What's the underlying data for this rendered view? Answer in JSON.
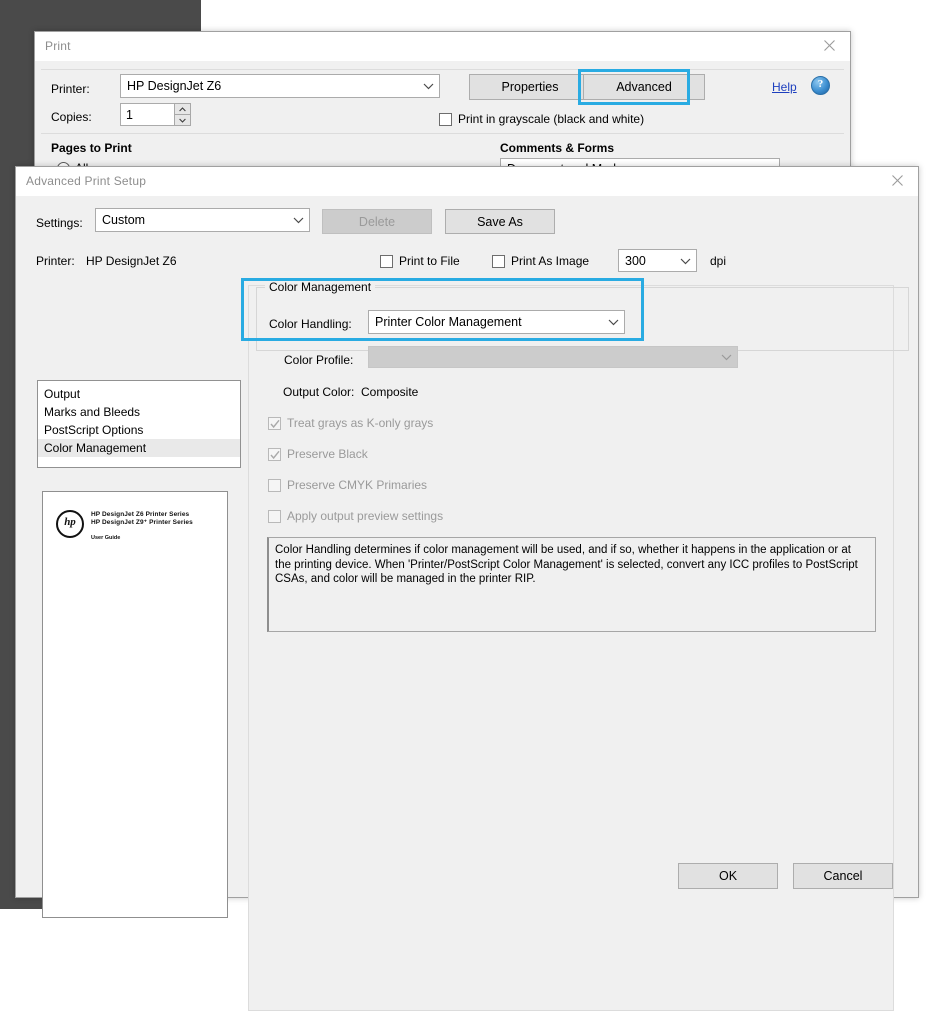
{
  "colors": {
    "highlight_accent": "#29ABE2",
    "desktop_backdrop": "#4a4a4a",
    "dialog_face": "#f0f0f0",
    "link_blue": "#1d3fbe"
  },
  "print_dialog": {
    "title": "Print",
    "close_icon": "close-icon",
    "printer_label": "Printer:",
    "printer_value": "HP DesignJet Z6",
    "copies_label": "Copies:",
    "copies_value": "1",
    "properties_button": "Properties",
    "advanced_button": "Advanced",
    "help_link": "Help",
    "help_icon": "question-mark-icon",
    "grayscale_checkbox": "Print in grayscale (black and white)",
    "grayscale_checked": false,
    "pages_to_print_label": "Pages to Print",
    "pages_all_option": "All",
    "comments_and_forms_label": "Comments & Forms",
    "comments_and_forms_value": "Document and Markups"
  },
  "advanced_dialog": {
    "title": "Advanced Print Setup",
    "close_icon": "close-icon",
    "settings_label": "Settings:",
    "settings_value": "Custom",
    "delete_button": "Delete",
    "delete_enabled": false,
    "save_as_button": "Save As",
    "printer_label": "Printer:",
    "printer_value": "HP DesignJet Z6",
    "print_to_file_checkbox": "Print to File",
    "print_to_file_checked": false,
    "print_as_image_checkbox": "Print As Image",
    "print_as_image_checked": false,
    "dpi_value": "300",
    "dpi_unit": "dpi",
    "categories": [
      {
        "label": "Output",
        "selected": false
      },
      {
        "label": "Marks and Bleeds",
        "selected": false
      },
      {
        "label": "PostScript Options",
        "selected": false
      },
      {
        "label": "Color Management",
        "selected": true
      }
    ],
    "preview": {
      "logo_icon": "hp-logo-icon",
      "line1": "HP DesignJet Z6 Printer Series",
      "line2": "HP DesignJet Z9⁺ Printer Series",
      "line3": "User Guide"
    },
    "color_management": {
      "group_title": "Color Management",
      "color_handling_label": "Color Handling:",
      "color_handling_value": "Printer Color Management",
      "color_profile_label": "Color Profile:",
      "color_profile_value": "",
      "color_profile_enabled": false,
      "output_color_label": "Output Color:",
      "output_color_value": "Composite",
      "options": [
        {
          "label": "Treat grays as K-only grays",
          "checked": true,
          "enabled": false
        },
        {
          "label": "Preserve Black",
          "checked": true,
          "enabled": false
        },
        {
          "label": "Preserve CMYK Primaries",
          "checked": false,
          "enabled": false
        },
        {
          "label": "Apply output preview settings",
          "checked": false,
          "enabled": false
        }
      ],
      "description": "Color Handling determines if color management will be used, and if so, whether it happens in the application or at the printing device. When 'Printer/PostScript Color Management' is selected, convert any ICC profiles to PostScript CSAs, and color will be managed in the printer RIP."
    },
    "ok_button": "OK",
    "cancel_button": "Cancel"
  }
}
